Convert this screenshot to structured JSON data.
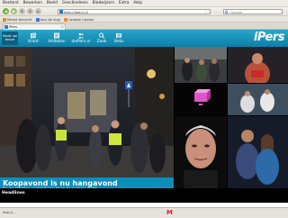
{
  "browser": {
    "menu": [
      "Bestand",
      "Bewerken",
      "Beeld",
      "Geschiedenis",
      "Bladwijzers",
      "Extra",
      "Help"
    ],
    "url": "http://ipers.nl/",
    "search_placeholder": "Google",
    "bookmarks": [
      "Meest bezocht",
      "Aan de slag",
      "Laatste nieuws"
    ],
    "tab_title": "iPers"
  },
  "site": {
    "logo": "iPers",
    "maak_button": "Maak uw keuze",
    "nav": [
      {
        "label": "Krant"
      },
      {
        "label": "Artikelen"
      },
      {
        "label": "deiPers.nl"
      },
      {
        "label": "Zoek"
      },
      {
        "label": "Beta"
      }
    ],
    "hero": {
      "headline": "Koopavond is nu hangavond",
      "subline": "Geen klanten, winkeliers doen hun zaak dicht"
    },
    "headlines_label": "Headlines"
  },
  "status": {
    "left": "http://...",
    "right": ""
  },
  "colors": {
    "header_top": "#2aa5c9",
    "header_bottom": "#0d7fa8",
    "caption_bg": "#0b8fba",
    "page_bg": "#000000"
  }
}
